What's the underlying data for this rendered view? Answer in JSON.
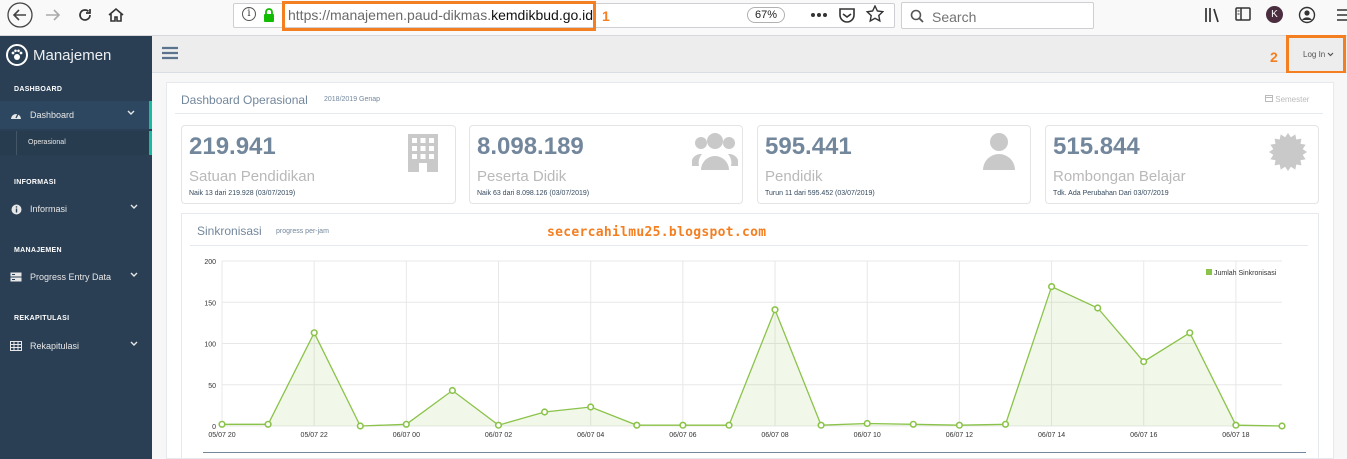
{
  "browser": {
    "url_prefix": "https://manajemen.paud-dikmas.",
    "url_domain": "kemdikbud.go.id",
    "zoom": "67%",
    "search_placeholder": "Search",
    "profile_letter": "K",
    "annotation_1": "1",
    "annotation_2": "2"
  },
  "sidebar": {
    "brand": "Manajemen",
    "sections": [
      {
        "head": "DASHBOARD",
        "item": "Dashboard",
        "sub": "Operasional"
      },
      {
        "head": "INFORMASI",
        "item": "Informasi"
      },
      {
        "head": "MANAJEMEN",
        "item": "Progress Entry Data"
      },
      {
        "head": "REKAPITULASI",
        "item": "Rekapitulasi"
      }
    ]
  },
  "topnav": {
    "login": "Log In"
  },
  "panel": {
    "title": "Dashboard Operasional",
    "period": "2018/2019 Genap",
    "semester": "Semester"
  },
  "tiles": [
    {
      "value": "219.941",
      "label": "Satuan Pendidikan",
      "foot": "Naik 13 dari 219.928 (03/07/2019)"
    },
    {
      "value": "8.098.189",
      "label": "Peserta Didik",
      "foot": "Naik 63 dari 8.098.126 (03/07/2019)"
    },
    {
      "value": "595.441",
      "label": "Pendidik",
      "foot": "Turun 11 dari 595.452 (03/07/2019)"
    },
    {
      "value": "515.844",
      "label": "Rombongan Belajar",
      "foot": "Tdk. Ada Perubahan Dari 03/07/2019"
    }
  ],
  "watermark": "secercahilmu25.blogspot.com",
  "chart_data": {
    "type": "area",
    "title": "Sinkronisasi",
    "subtitle": "progress per-jam",
    "legend": "Jumlah Sinkronisasi",
    "legend_position": "top-right",
    "color": "#8bc34a",
    "grid": true,
    "ylim": [
      0,
      200
    ],
    "yticks": [
      0,
      50,
      100,
      150,
      200
    ],
    "xtick_labels": [
      "05/07 20",
      "05/07 22",
      "06/07 00",
      "06/07 02",
      "06/07 04",
      "06/07 06",
      "06/07 08",
      "06/07 10",
      "06/07 12",
      "06/07 14",
      "06/07 16",
      "06/07 18"
    ],
    "series": [
      {
        "name": "Jumlah Sinkronisasi",
        "values": [
          2,
          2,
          113,
          0,
          2,
          43,
          1,
          17,
          23,
          1,
          1,
          1,
          141,
          1,
          3,
          2,
          1,
          2,
          169,
          143,
          78,
          113,
          1,
          0
        ]
      }
    ]
  }
}
